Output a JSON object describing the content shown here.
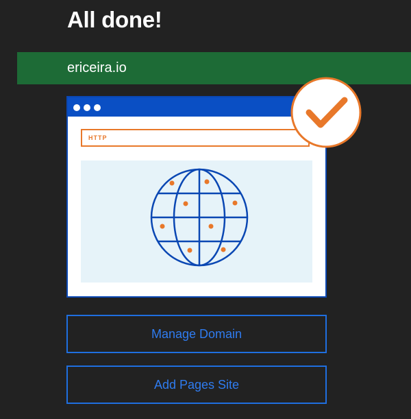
{
  "header": {
    "title": "All done!"
  },
  "domain_banner": {
    "domain": "ericeira.io",
    "color": "#1d6b36"
  },
  "illustration": {
    "url_bar_text": "HTTP",
    "icons": [
      "browser-window-icon",
      "globe-icon",
      "checkmark-icon"
    ],
    "colors": {
      "frame": "#0a47b3",
      "accent": "#e8782a",
      "content_bg": "#e6f3f9"
    }
  },
  "actions": {
    "manage_domain_label": "Manage Domain",
    "add_pages_site_label": "Add Pages Site",
    "color": "#2f7cf0"
  }
}
